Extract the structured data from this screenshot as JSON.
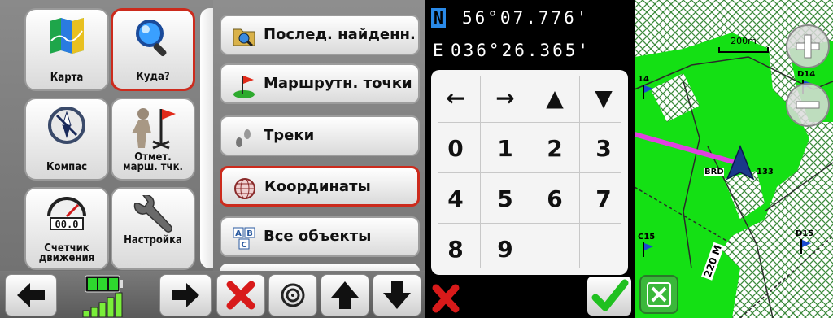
{
  "main_menu": {
    "tiles": [
      {
        "label": "Карта",
        "icon": "map-icon"
      },
      {
        "label": "Куда?",
        "icon": "magnifier-icon"
      },
      {
        "label": "Компас",
        "icon": "compass-icon"
      },
      {
        "label_line1": "Отмет.",
        "label_line2": "марш. тчк.",
        "icon": "mark-waypoint-icon"
      },
      {
        "label_line1": "Счетчик",
        "label_line2": "движения",
        "icon": "trip-computer-icon",
        "readout": "00.0"
      },
      {
        "label": "Настройка",
        "icon": "wrench-icon"
      }
    ],
    "selected": "Куда?",
    "battery_icon": "battery-icon",
    "signal_icon": "signal-strength-icon"
  },
  "where_to": {
    "items": [
      {
        "label": "Послед. найденн.",
        "icon": "recent-folder-icon"
      },
      {
        "label": "Маршрутн. точки",
        "icon": "waypoint-flag-icon"
      },
      {
        "label": "Треки",
        "icon": "track-footprints-icon"
      },
      {
        "label": "Координаты",
        "icon": "globe-icon"
      },
      {
        "label": "Все объекты",
        "icon": "all-poi-icon"
      }
    ],
    "selected": "Координаты",
    "toolbar": [
      "close-icon",
      "target-icon",
      "up-arrow-icon",
      "down-arrow-icon"
    ]
  },
  "coordinate_entry": {
    "lat_hemisphere": "N",
    "lat_value": "56°07.776'",
    "lon_hemisphere": "E",
    "lon_value": "036°26.365'",
    "keys": [
      "←",
      "→",
      "▲",
      "▼",
      "0",
      "1",
      "2",
      "3",
      "4",
      "5",
      "6",
      "7",
      "8",
      "9"
    ],
    "cancel_icon": "cancel-x-icon",
    "confirm_icon": "checkmark-icon"
  },
  "map": {
    "scale_label": "200m",
    "waypoints": [
      "14",
      "D14",
      "BRD",
      "133",
      "C15",
      "D15"
    ],
    "road_label": "220 M",
    "zoom_in_icon": "zoom-in-icon",
    "zoom_out_icon": "zoom-out-icon",
    "close_icon": "close-map-icon",
    "colors": {
      "forest": "#14e014",
      "track": "#e040e0",
      "contour": "#2a2a2a",
      "hatch": "#3c8a3c"
    }
  }
}
